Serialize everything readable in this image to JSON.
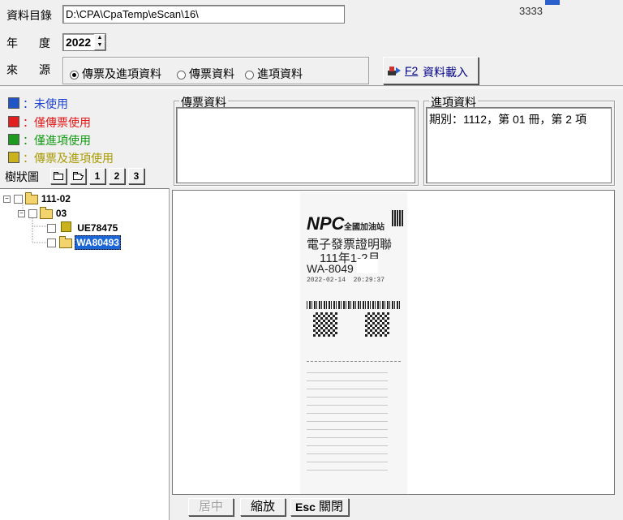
{
  "toolbar": {
    "dir_label": "資料目錄",
    "dir_value": "D:\\CPA\\CpaTemp\\eScan\\16\\",
    "year_label": "年　度",
    "year_value": "2022",
    "source_label": "來　源",
    "source_options": [
      "傳票及進項資料",
      "傳票資料",
      "進項資料"
    ],
    "source_selected": 0,
    "load_key": "F2",
    "load_label": "資料載入",
    "corner_number": "3333"
  },
  "legend": {
    "items": [
      {
        "text": "：未使用",
        "color": "#1f55c6",
        "text_color": "#1b3fd1"
      },
      {
        "text": "：僅傳票使用",
        "color": "#e32020",
        "text_color": "#e01818"
      },
      {
        "text": "：僅進項使用",
        "color": "#1e9a1e",
        "text_color": "#119a11"
      },
      {
        "text": "：傳票及進項使用",
        "color": "#c9b21c",
        "text_color": "#a89a00"
      }
    ]
  },
  "tree_toolbar": {
    "label": "樹狀圖",
    "buttons": [
      "1",
      "2",
      "3"
    ]
  },
  "tree": {
    "root": "111-02",
    "child": "03",
    "leaf1": "UE78475",
    "leaf2": "WA80493"
  },
  "panels": {
    "voucher_title": "傳票資料",
    "input_title": "進項資料",
    "input_text": "期別：1112，第 01 冊，第 2 項"
  },
  "receipt": {
    "brand": "NPC",
    "brand_sub": "全國加油站",
    "doc_title": "電子發票證明聯",
    "period": "111年1-2月",
    "number": "WA-8049"
  },
  "bottom_buttons": {
    "center": "居中",
    "zoom": "縮放",
    "esc_key": "Esc",
    "close": "關閉"
  }
}
